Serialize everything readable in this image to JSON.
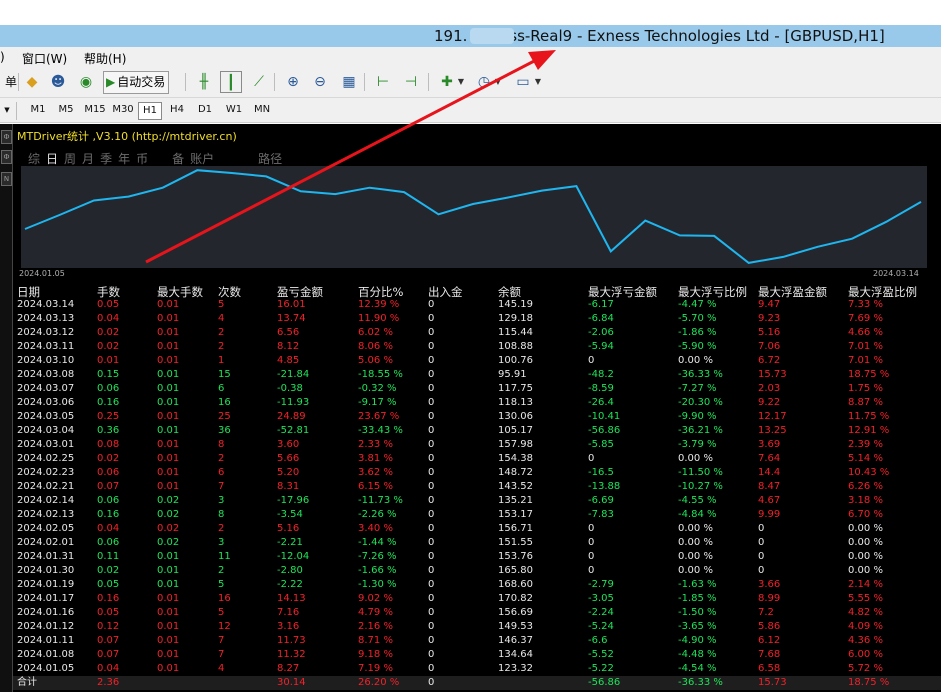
{
  "window": {
    "title": "191.         Exness-Real9 - Exness Technologies Ltd - [GBPUSD,H1]"
  },
  "menu": {
    "items": [
      ")",
      "窗口(W)",
      "帮助(H)"
    ]
  },
  "toolbar": {
    "left_partial": "单",
    "auto_trade_label": "自动交易"
  },
  "timeframes": [
    "M1",
    "M5",
    "M15",
    "M30",
    "H1",
    "H4",
    "D1",
    "W1",
    "MN"
  ],
  "timeframe_active": "H1",
  "indicator": {
    "title": "MTDriver统计 ,V3.10 (http://mtdriver.cn)"
  },
  "tabs": [
    "综",
    "日",
    "周",
    "月",
    "季",
    "年",
    "币",
    "啊",
    "备",
    "账户",
    "路径"
  ],
  "tab_active": "日",
  "chart_data": {
    "type": "line",
    "x_start_label": "2024.01.05",
    "x_end_label": "2024.03.14",
    "x": [
      "2024.01.05",
      "2024.01.08",
      "2024.01.11",
      "2024.01.12",
      "2024.01.16",
      "2024.01.17",
      "2024.01.19",
      "2024.01.30",
      "2024.01.31",
      "2024.02.01",
      "2024.02.05",
      "2024.02.13",
      "2024.02.14",
      "2024.02.21",
      "2024.02.23",
      "2024.02.25",
      "2024.03.01",
      "2024.03.04",
      "2024.03.05",
      "2024.03.06",
      "2024.03.07",
      "2024.03.08",
      "2024.03.10",
      "2024.03.11",
      "2024.03.12",
      "2024.03.13",
      "2024.03.14"
    ],
    "values": [
      123.32,
      134.64,
      146.37,
      149.53,
      156.69,
      170.82,
      168.6,
      165.8,
      153.76,
      151.55,
      156.71,
      153.17,
      135.21,
      143.52,
      148.72,
      154.38,
      157.98,
      105.17,
      130.06,
      118.13,
      117.75,
      95.91,
      100.76,
      108.88,
      115.44,
      129.18,
      145.19
    ],
    "ylim": [
      95,
      171
    ],
    "color": "#1fb6f0",
    "grid": false
  },
  "table": {
    "headers": [
      "日期",
      "手数",
      "最大手数",
      "次数",
      "盈亏金额",
      "百分比%",
      "出入金",
      "余额",
      "最大浮亏金额",
      "最大浮亏比例",
      "最大浮盈金额",
      "最大浮盈比例"
    ],
    "rows": [
      [
        "2024.03.14",
        "0.05",
        "0.01",
        "5",
        "16.01",
        "12.39 %",
        "0",
        "145.19",
        "-6.17",
        "-4.47 %",
        "9.47",
        "7.33 %"
      ],
      [
        "2024.03.13",
        "0.04",
        "0.01",
        "4",
        "13.74",
        "11.90 %",
        "0",
        "129.18",
        "-6.84",
        "-5.70 %",
        "9.23",
        "7.69 %"
      ],
      [
        "2024.03.12",
        "0.02",
        "0.01",
        "2",
        "6.56",
        "6.02 %",
        "0",
        "115.44",
        "-2.06",
        "-1.86 %",
        "5.16",
        "4.66 %"
      ],
      [
        "2024.03.11",
        "0.02",
        "0.01",
        "2",
        "8.12",
        "8.06 %",
        "0",
        "108.88",
        "-5.94",
        "-5.90 %",
        "7.06",
        "7.01 %"
      ],
      [
        "2024.03.10",
        "0.01",
        "0.01",
        "1",
        "4.85",
        "5.06 %",
        "0",
        "100.76",
        "0",
        "0.00 %",
        "6.72",
        "7.01 %"
      ],
      [
        "2024.03.08",
        "0.15",
        "0.01",
        "15",
        "-21.84",
        "-18.55 %",
        "0",
        "95.91",
        "-48.2",
        "-36.33 %",
        "15.73",
        "18.75 %"
      ],
      [
        "2024.03.07",
        "0.06",
        "0.01",
        "6",
        "-0.38",
        "-0.32 %",
        "0",
        "117.75",
        "-8.59",
        "-7.27 %",
        "2.03",
        "1.75 %"
      ],
      [
        "2024.03.06",
        "0.16",
        "0.01",
        "16",
        "-11.93",
        "-9.17 %",
        "0",
        "118.13",
        "-26.4",
        "-20.30 %",
        "9.22",
        "8.87 %"
      ],
      [
        "2024.03.05",
        "0.25",
        "0.01",
        "25",
        "24.89",
        "23.67 %",
        "0",
        "130.06",
        "-10.41",
        "-9.90 %",
        "12.17",
        "11.75 %"
      ],
      [
        "2024.03.04",
        "0.36",
        "0.01",
        "36",
        "-52.81",
        "-33.43 %",
        "0",
        "105.17",
        "-56.86",
        "-36.21 %",
        "13.25",
        "12.91 %"
      ],
      [
        "2024.03.01",
        "0.08",
        "0.01",
        "8",
        "3.60",
        "2.33 %",
        "0",
        "157.98",
        "-5.85",
        "-3.79 %",
        "3.69",
        "2.39 %"
      ],
      [
        "2024.02.25",
        "0.02",
        "0.01",
        "2",
        "5.66",
        "3.81 %",
        "0",
        "154.38",
        "0",
        "0.00 %",
        "7.64",
        "5.14 %"
      ],
      [
        "2024.02.23",
        "0.06",
        "0.01",
        "6",
        "5.20",
        "3.62 %",
        "0",
        "148.72",
        "-16.5",
        "-11.50 %",
        "14.4",
        "10.43 %"
      ],
      [
        "2024.02.21",
        "0.07",
        "0.01",
        "7",
        "8.31",
        "6.15 %",
        "0",
        "143.52",
        "-13.88",
        "-10.27 %",
        "8.47",
        "6.26 %"
      ],
      [
        "2024.02.14",
        "0.06",
        "0.02",
        "3",
        "-17.96",
        "-11.73 %",
        "0",
        "135.21",
        "-6.69",
        "-4.55 %",
        "4.67",
        "3.18 %"
      ],
      [
        "2024.02.13",
        "0.16",
        "0.02",
        "8",
        "-3.54",
        "-2.26 %",
        "0",
        "153.17",
        "-7.83",
        "-4.84 %",
        "9.99",
        "6.70 %"
      ],
      [
        "2024.02.05",
        "0.04",
        "0.02",
        "2",
        "5.16",
        "3.40 %",
        "0",
        "156.71",
        "0",
        "0.00 %",
        "0",
        "0.00 %"
      ],
      [
        "2024.02.01",
        "0.06",
        "0.02",
        "3",
        "-2.21",
        "-1.44 %",
        "0",
        "151.55",
        "0",
        "0.00 %",
        "0",
        "0.00 %"
      ],
      [
        "2024.01.31",
        "0.11",
        "0.01",
        "11",
        "-12.04",
        "-7.26 %",
        "0",
        "153.76",
        "0",
        "0.00 %",
        "0",
        "0.00 %"
      ],
      [
        "2024.01.30",
        "0.02",
        "0.01",
        "2",
        "-2.80",
        "-1.66 %",
        "0",
        "165.80",
        "0",
        "0.00 %",
        "0",
        "0.00 %"
      ],
      [
        "2024.01.19",
        "0.05",
        "0.01",
        "5",
        "-2.22",
        "-1.30 %",
        "0",
        "168.60",
        "-2.79",
        "-1.63 %",
        "3.66",
        "2.14 %"
      ],
      [
        "2024.01.17",
        "0.16",
        "0.01",
        "16",
        "14.13",
        "9.02 %",
        "0",
        "170.82",
        "-3.05",
        "-1.85 %",
        "8.99",
        "5.55 %"
      ],
      [
        "2024.01.16",
        "0.05",
        "0.01",
        "5",
        "7.16",
        "4.79 %",
        "0",
        "156.69",
        "-2.24",
        "-1.50 %",
        "7.2",
        "4.82 %"
      ],
      [
        "2024.01.12",
        "0.12",
        "0.01",
        "12",
        "3.16",
        "2.16 %",
        "0",
        "149.53",
        "-5.24",
        "-3.65 %",
        "5.86",
        "4.09 %"
      ],
      [
        "2024.01.11",
        "0.07",
        "0.01",
        "7",
        "11.73",
        "8.71 %",
        "0",
        "146.37",
        "-6.6",
        "-4.90 %",
        "6.12",
        "4.36 %"
      ],
      [
        "2024.01.08",
        "0.07",
        "0.01",
        "7",
        "11.32",
        "9.18 %",
        "0",
        "134.64",
        "-5.52",
        "-4.48 %",
        "7.68",
        "6.00 %"
      ],
      [
        "2024.01.05",
        "0.04",
        "0.01",
        "4",
        "8.27",
        "7.19 %",
        "0",
        "123.32",
        "-5.22",
        "-4.54 %",
        "6.58",
        "5.72 %"
      ]
    ],
    "total": [
      "合计",
      "2.36",
      "",
      "",
      "30.14",
      "26.20 %",
      "0",
      "",
      "-56.86",
      "-36.33 %",
      "15.73",
      "18.75 %"
    ]
  },
  "colors": {
    "profit": "#f0222a",
    "loss": "#1fe35a",
    "line": "#1fb6f0",
    "arrow": "#e8141b",
    "indicator_title": "#f2df2a",
    "titlebar": "#99c9ea"
  },
  "left_strip_labels": [
    "Ф",
    "Ф",
    "N"
  ]
}
